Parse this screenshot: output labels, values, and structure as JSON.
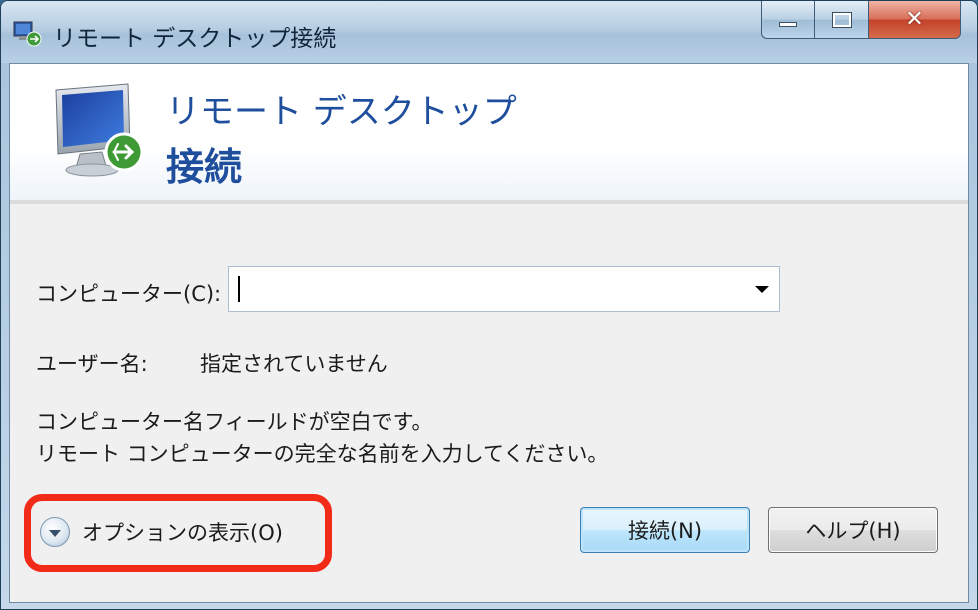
{
  "window": {
    "title": "リモート デスクトップ接続",
    "icon": "remote-desktop-icon"
  },
  "caption_buttons": {
    "minimize_icon": "minimize-icon",
    "maximize_icon": "maximize-icon",
    "close_glyph": "✕"
  },
  "banner": {
    "line1": "リモート デスクトップ",
    "line2": "接続"
  },
  "form": {
    "computer_label": "コンピューター(C):",
    "computer_value": "",
    "computer_placeholder": "",
    "user_label": "ユーザー名:",
    "user_value": "指定されていません"
  },
  "message": {
    "line1": "コンピューター名フィールドが空白です。",
    "line2": "リモート コンピューターの完全な名前を入力してください。"
  },
  "options": {
    "label": "オプションの表示(O)"
  },
  "buttons": {
    "connect": "接続(N)",
    "help": "ヘルプ(H)"
  },
  "colors": {
    "banner_text": "#1e4e9c",
    "highlight": "#f22a18"
  }
}
